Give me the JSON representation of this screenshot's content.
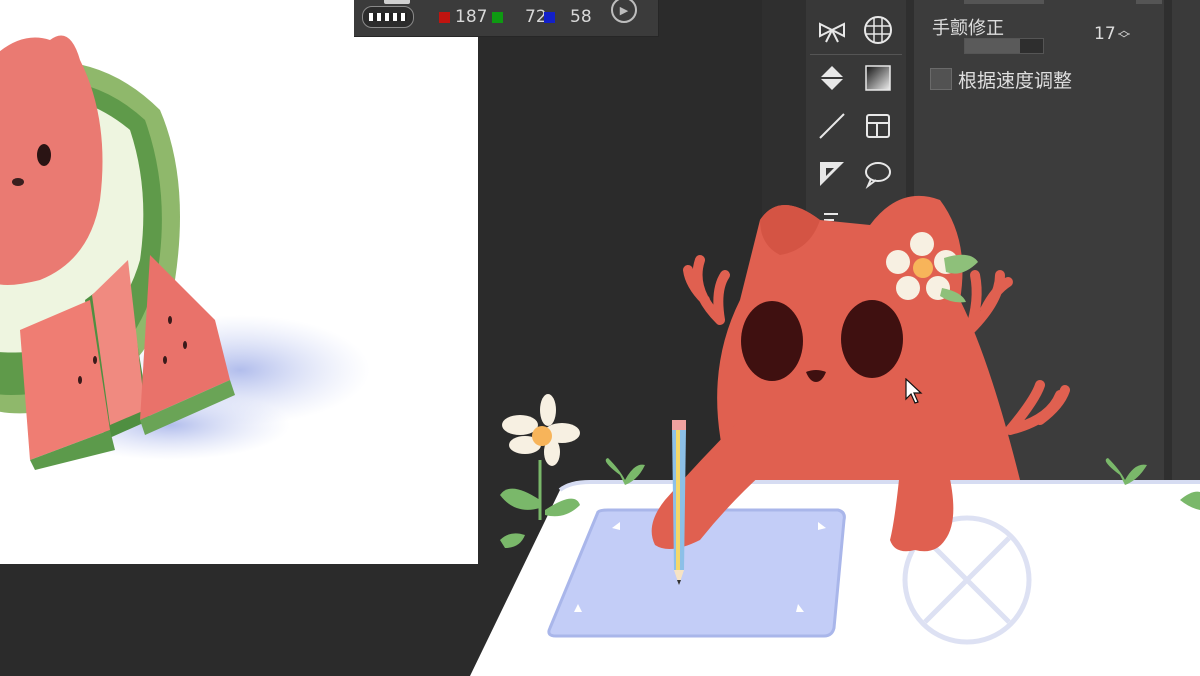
{
  "color_bar": {
    "r_value": "187",
    "g_value": "72",
    "b_value": "58",
    "swatches": {
      "r": "#c0140f",
      "g": "#0e9a12",
      "b": "#1220c8"
    }
  },
  "icons": {
    "texture": "texture-pattern-icon",
    "play": "play-icon",
    "ribbon": "ribbon-icon",
    "grid_sphere": "perspective-grid-icon",
    "fill": "fill-bucket-icon",
    "gradient": "gradient-icon",
    "line": "line-icon",
    "frame": "frame-border-icon",
    "ruler": "ruler-icon",
    "balloon": "speech-balloon-icon",
    "more": "more-tools-icon"
  },
  "properties": {
    "stabilization_label": "手颤修正",
    "stabilization_value": "17",
    "speed_adjust_label": "根据速度调整",
    "speed_adjust_checked": false
  },
  "colors": {
    "bg": "#2b2b2b",
    "panel": "#3c3c3c",
    "mascot": "#e06050",
    "tablet": "#c5cff8"
  }
}
